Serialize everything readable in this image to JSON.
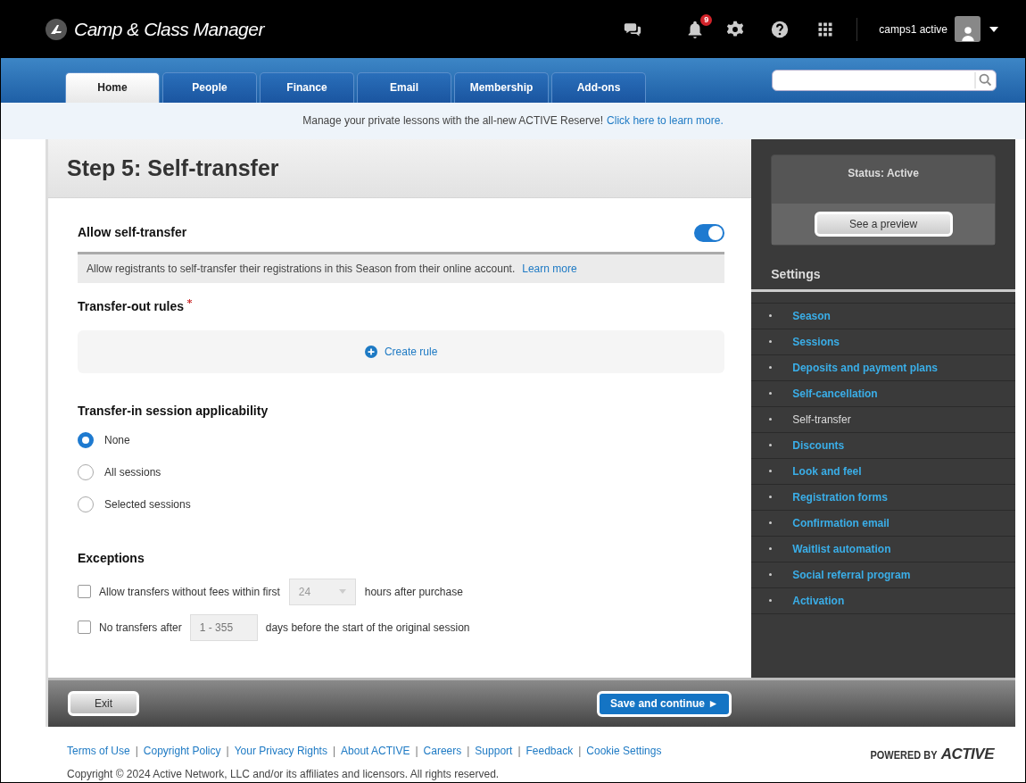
{
  "app": {
    "title": "Camp & Class Manager",
    "notification_count": "9",
    "user_name": "camps1 active"
  },
  "tabs": [
    {
      "label": "Home",
      "selected": true
    },
    {
      "label": "People",
      "selected": false
    },
    {
      "label": "Finance",
      "selected": false
    },
    {
      "label": "Email",
      "selected": false
    },
    {
      "label": "Membership",
      "selected": false
    },
    {
      "label": "Add-ons",
      "selected": false
    }
  ],
  "banner": {
    "text": "Manage your private lessons with the all-new ACTIVE Reserve!",
    "link": "Click here to learn more."
  },
  "page_title": "Step 5: Self-transfer",
  "allow_self_transfer": {
    "label": "Allow self-transfer",
    "on": true,
    "description": "Allow registrants to self-transfer their registrations in this Season from their online account.",
    "learn_more": "Learn more"
  },
  "transfer_out": {
    "label": "Transfer-out rules",
    "required": true,
    "create_rule": "Create rule"
  },
  "transfer_in": {
    "label": "Transfer-in session applicability",
    "options": [
      {
        "label": "None",
        "selected": true
      },
      {
        "label": "All sessions",
        "selected": false
      },
      {
        "label": "Selected sessions",
        "selected": false
      }
    ]
  },
  "exceptions": {
    "label": "Exceptions",
    "items": [
      {
        "kind": "select",
        "checked": false,
        "before": "Allow transfers without fees within first",
        "value": "24",
        "after": "hours after purchase"
      },
      {
        "kind": "input",
        "checked": false,
        "before": "No transfers after",
        "placeholder": "1 - 355",
        "after": "days before the start of the original session"
      }
    ]
  },
  "buttons": {
    "exit": "Exit",
    "save": "Save and continue ►"
  },
  "sidebar": {
    "status": "Status: Active",
    "preview": "See a preview",
    "settings_title": "Settings",
    "items": [
      {
        "label": "Season",
        "selected": false
      },
      {
        "label": "Sessions",
        "selected": false
      },
      {
        "label": "Deposits and payment plans",
        "selected": false
      },
      {
        "label": "Self-cancellation",
        "selected": false
      },
      {
        "label": "Self-transfer",
        "selected": true
      },
      {
        "label": "Discounts",
        "selected": false
      },
      {
        "label": "Look and feel",
        "selected": false
      },
      {
        "label": "Registration forms",
        "selected": false
      },
      {
        "label": "Confirmation email",
        "selected": false
      },
      {
        "label": "Waitlist automation",
        "selected": false
      },
      {
        "label": "Social referral program",
        "selected": false
      },
      {
        "label": "Activation",
        "selected": false
      }
    ]
  },
  "footer": {
    "links": [
      "Terms of Use",
      "Copyright Policy",
      "Your Privacy Rights",
      "About ACTIVE",
      "Careers",
      "Support",
      "Feedback",
      "Cookie Settings"
    ],
    "separator": "|",
    "copyright": "Copyright © 2024 Active Network, LLC and/or its affiliates and licensors. All rights reserved.",
    "powered_by": "POWERED BY",
    "brand": "ACTIVE"
  }
}
